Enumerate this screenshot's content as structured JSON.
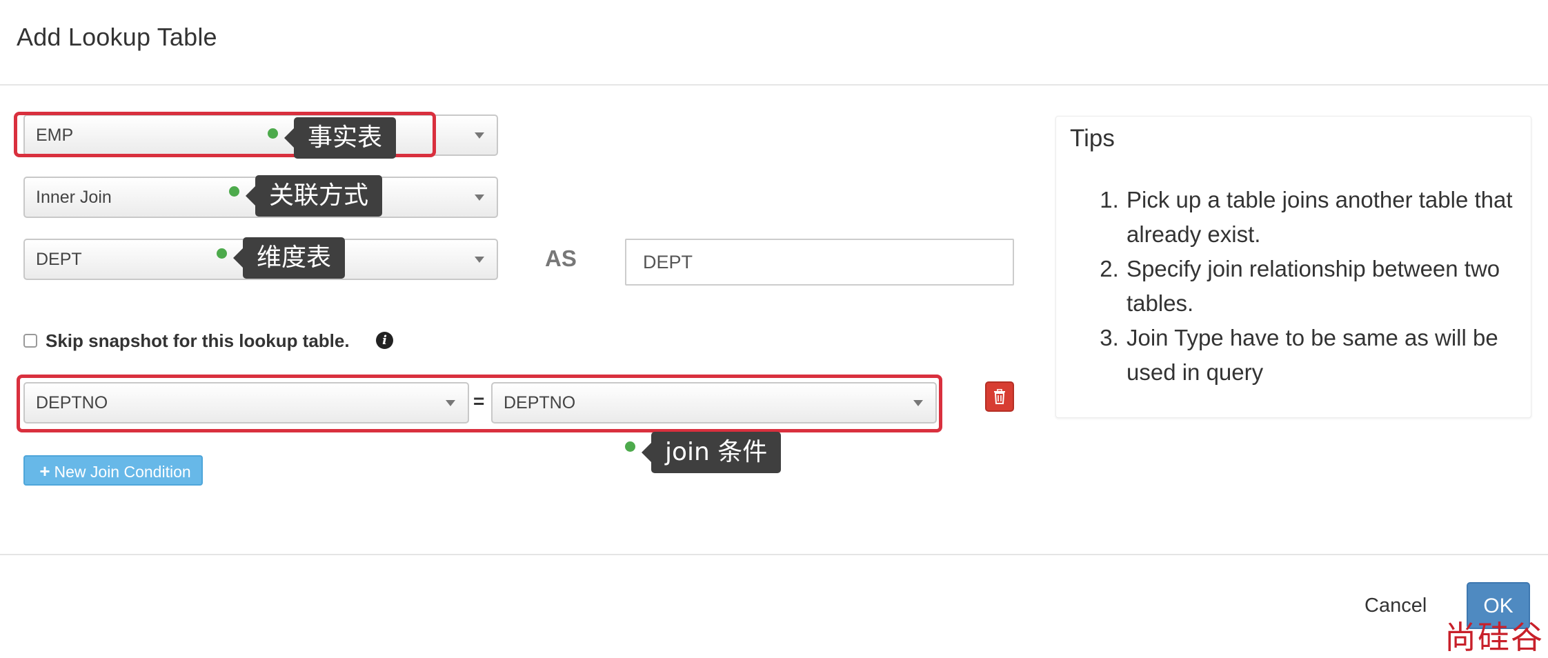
{
  "dialog": {
    "title": "Add Lookup Table"
  },
  "form": {
    "fact_table_select": {
      "value": "EMP",
      "tooltip": "事实表"
    },
    "join_type_select": {
      "value": "Inner Join",
      "tooltip": "关联方式"
    },
    "lookup_table_select": {
      "value": "DEPT",
      "tooltip": "维度表"
    },
    "as_label": "AS",
    "alias_input": {
      "value": "DEPT"
    },
    "skip_snapshot": {
      "label": "Skip snapshot for this lookup table.",
      "checked": false
    },
    "join_condition": {
      "left_column": "DEPTNO",
      "operator": "=",
      "right_column": "DEPTNO",
      "tooltip": "join 条件"
    },
    "new_join_condition_label": "New Join Condition"
  },
  "tips": {
    "title": "Tips",
    "items": [
      "Pick up a table joins another table that already exist.",
      "Specify join relationship between two tables.",
      "Join Type have to be same as will be used in query"
    ]
  },
  "footer": {
    "cancel_label": "Cancel",
    "ok_label": "OK"
  },
  "watermark": "尚硅谷",
  "colors": {
    "highlight_border": "#d9303e",
    "tooltip_bg": "#3f3f3f",
    "tip_dot": "#4daa4c",
    "primary_button": "#4f8ac1",
    "info_button": "#67b8e8",
    "danger_button": "#d73d32"
  }
}
